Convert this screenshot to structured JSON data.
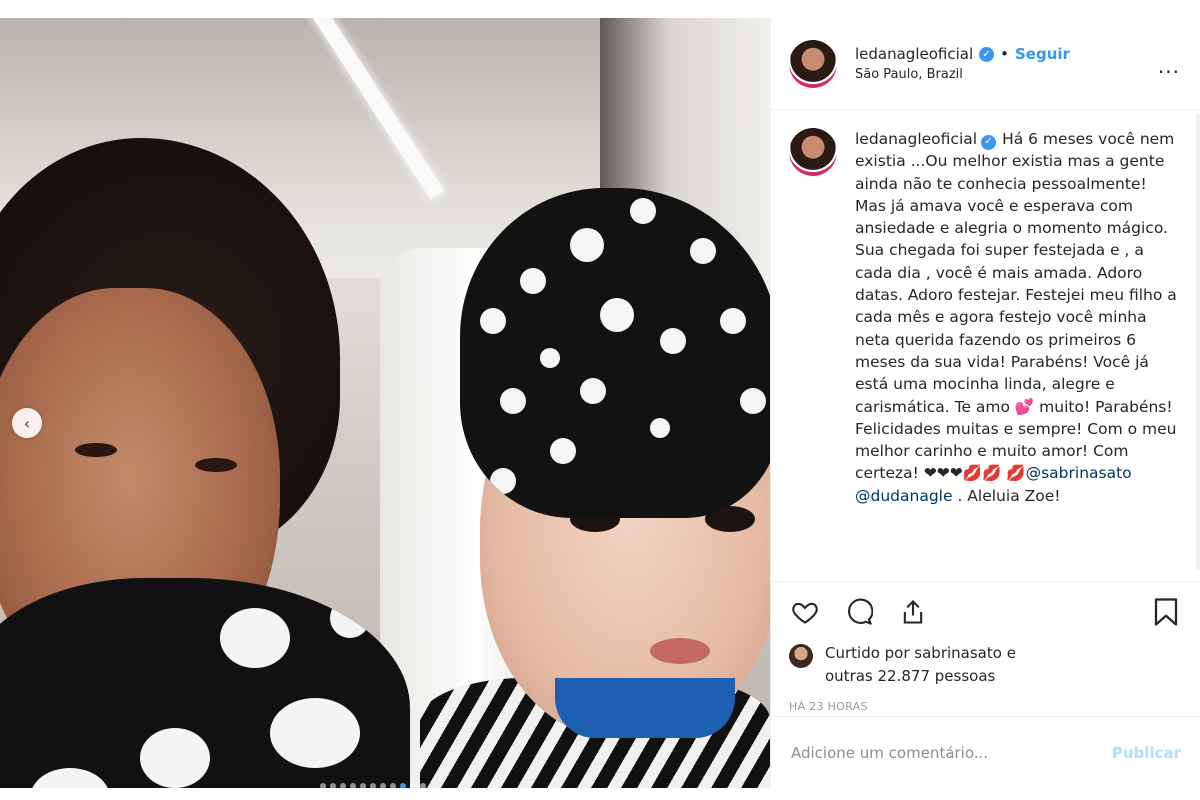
{
  "post": {
    "username": "ledanagleoficial",
    "follow_label": "Seguir",
    "separator": "•",
    "location": "São Paulo, Brazil",
    "more_label": "...",
    "caption_part1": "Há 6 meses você nem existia ...Ou melhor existia mas a gente ainda não te conhecia pessoalmente! Mas já amava você e esperava com ansiedade e alegria o momento mágico. Sua chegada foi super festejada e , a cada dia , você é mais amada. Adoro datas. Adoro festejar. Festejei meu filho a cada mês e agora festejo você minha neta querida fazendo os primeiros 6 meses da sua vida! Parabéns! Você já está uma mocinha linda, alegre e carismática. Te amo 💕 muito! Parabéns! Felicidades muitas e sempre! Com o meu melhor carinho e muito amor! Com certeza! ❤❤❤💋💋 💋",
    "mention1": "@sabrinasato",
    "mention2": "@dudanagle",
    "caption_end": ". Aleluia Zoe!",
    "liked_by_line1": "Curtido por sabrinasato e",
    "liked_by_line2": "outras 22.877 pessoas",
    "timestamp": "HÁ 23 HORAS",
    "comment_placeholder": "Adicione um comentário...",
    "publish_label": "Publicar",
    "prev_label": "‹"
  },
  "colors": {
    "accent": "#3897f0",
    "publish_disabled": "#b2dffc",
    "text": "#262626",
    "muted": "#999999"
  },
  "icons": {
    "verified": "verified-badge-icon",
    "like": "heart-icon",
    "comment": "comment-icon",
    "share": "share-icon",
    "save": "bookmark-icon"
  }
}
